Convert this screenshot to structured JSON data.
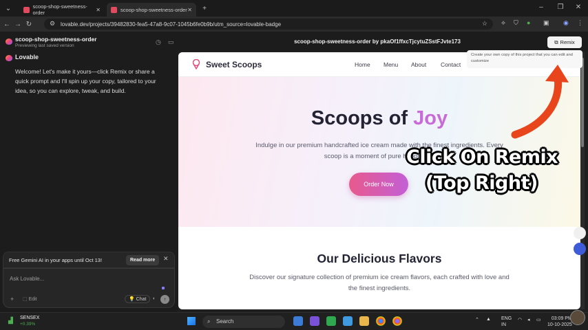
{
  "browser": {
    "tabs": [
      {
        "label": "scoop-shop-sweetness-order",
        "active": false
      },
      {
        "label": "scoop-shop-sweetness-order",
        "active": true
      }
    ],
    "url": "lovable.dev/projects/3948283​0-fea5-47a8-9c07-1045b6fe0b9b?utm_source=lovable-badge",
    "url_display": "lovable.dev/projects/39482830-fea5-47a8-9c07-1045b6fe0b9b/utm_source=lovable-badge"
  },
  "left_panel": {
    "project_name": "scoop-shop-sweetness-order",
    "project_status": "Previewing last saved version",
    "sender": "Lovable",
    "message": "Welcome! Let's make it yours—click Remix or share a quick prompt and I'll spin up your copy, tailored to your idea, so you can explore, tweak, and build.",
    "banner_text": "Free Gemini AI in your apps until Oct 13!",
    "banner_button": "Read more",
    "ask_placeholder": "Ask Lovable...",
    "edit_label": "Edit",
    "chat_label": "Chat"
  },
  "preview_header": {
    "title": "scoop-shop-sweetness-order by pkaOf1ffxcTjcytuZSstFJvte173",
    "remix_label": "Remix",
    "tooltip": "Create your own copy of this project that you can edit and customize"
  },
  "site": {
    "brand": "Sweet Scoops",
    "nav": [
      "Home",
      "Menu",
      "About",
      "Contact"
    ],
    "hero_title_main": "Scoops of",
    "hero_title_accent": "Joy",
    "hero_subtitle": "Indulge in our premium handcrafted ice cream made with the finest ingredients. Every scoop is a moment of pure happiness.",
    "order_button": "Order Now",
    "flavors_title": "Our Delicious Flavors",
    "flavors_subtitle": "Discover our signature collection of premium ice cream flavors, each crafted with love and the finest ingredients."
  },
  "overlay": {
    "line1": "Click On Remix",
    "line2": "(Top Right)",
    "arrow_color": "#e8451c"
  },
  "taskbar": {
    "ticker_name": "SENSEX",
    "ticker_change": "+0.39%",
    "search_label": "Search",
    "lang": "ENG",
    "region": "IN",
    "time": "03:09 PM",
    "date": "10-10-2025"
  },
  "colors": {
    "accent_pink": "#e85a8c",
    "accent_purple": "#c35fd6",
    "joy": "#c86bd6"
  }
}
